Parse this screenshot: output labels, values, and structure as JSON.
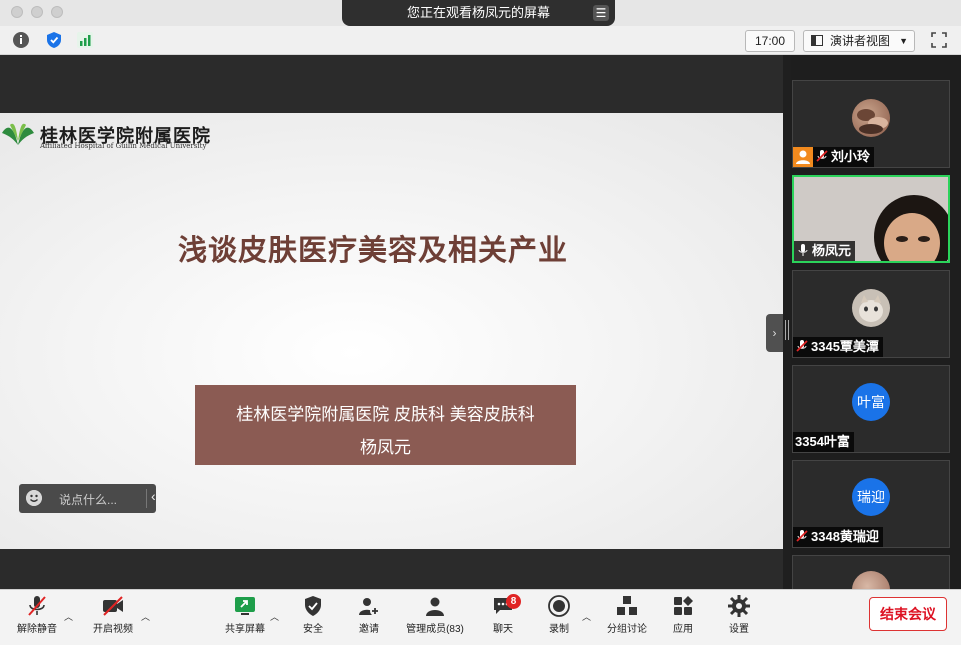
{
  "window": {
    "share_banner": "您正在观看杨凤元的屏幕"
  },
  "toolbar": {
    "time": "17:00",
    "view_mode": "演讲者视图"
  },
  "slide": {
    "hospital_cn": "桂林医学院附属医院",
    "hospital_en": "Affiliated Hospital of Guilin Medical University",
    "title": "浅谈皮肤医疗美容及相关产业",
    "subtitle_line1": "桂林医学院附属医院  皮肤科  美容皮肤科",
    "subtitle_line2": "杨凤元"
  },
  "chat": {
    "placeholder": "说点什么..."
  },
  "participants": [
    {
      "name": "刘小玲",
      "avatar": "photo",
      "muted": true
    },
    {
      "name": "杨凤元",
      "avatar": "video",
      "muted": false,
      "active": true
    },
    {
      "name": "3345覃美潭",
      "avatar": "photo-cat",
      "muted": true
    },
    {
      "name": "3354叶富",
      "avatar_text": "叶富",
      "muted": false
    },
    {
      "name": "3348黄瑞迎",
      "avatar_text": "瑞迎",
      "muted": true
    }
  ],
  "bottom": {
    "unmute": "解除静音",
    "start_video": "开启视频",
    "share_screen": "共享屏幕",
    "security": "安全",
    "invite": "邀请",
    "participants": "管理成员(83)",
    "chat": "聊天",
    "chat_badge": "8",
    "record": "录制",
    "breakout": "分组讨论",
    "apps": "应用",
    "settings": "设置",
    "end": "结束会议"
  },
  "colors": {
    "slide_title": "#6e3f36",
    "slide_box": "#8b5b53",
    "active_border": "#2bd35a",
    "end_red": "#d12"
  }
}
